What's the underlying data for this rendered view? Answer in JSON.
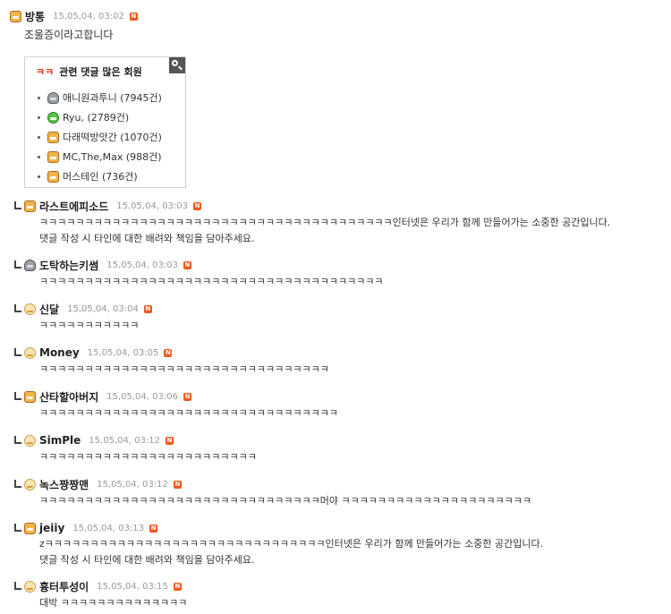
{
  "comments": [
    {
      "nick": "방통",
      "date": "15,05,04, 03:02",
      "lines": [
        "조울증이라고합니다"
      ]
    },
    {
      "nick": "라스트에피소드",
      "date": "15,05,04, 03:03",
      "lines": [
        "ㅋㅋㅋㅋㅋㅋㅋㅋㅋㅋㅋㅋㅋㅋㅋㅋㅋㅋㅋㅋㅋㅋㅋㅋㅋㅋㅋㅋㅋㅋㅋㅋㅋㅋㅋㅋㅋㅋㅋ인터넷은 우리가 함께 만들어가는 소중한 공간입니다.",
        "댓글 작성 시 타인에 대한 배려와 책임을 담아주세요."
      ]
    },
    {
      "nick": "도탁하는키썸",
      "date": "15,05,04, 03:03",
      "lines": [
        "ㅋㅋㅋㅋㅋㅋㅋㅋㅋㅋㅋㅋㅋㅋㅋㅋㅋㅋㅋㅋㅋㅋㅋㅋㅋㅋㅋㅋㅋㅋㅋㅋㅋㅋㅋㅋㅋㅋ"
      ]
    },
    {
      "nick": "신달",
      "date": "15,05,04, 03:04",
      "lines": [
        "ㅋㅋㅋㅋㅋㅋㅋㅋㅋㅋㅋ"
      ]
    },
    {
      "nick": "Money",
      "date": "15,05,04, 03:05",
      "lines": [
        "ㅋㅋㅋㅋㅋㅋㅋㅋㅋㅋㅋㅋㅋㅋㅋㅋㅋㅋㅋㅋㅋㅋㅋㅋㅋㅋㅋㅋㅋㅋㅋㅋ"
      ]
    },
    {
      "nick": "산타할아버지",
      "date": "15,05,04, 03:06",
      "lines": [
        "ㅋㅋㅋㅋㅋㅋㅋㅋㅋㅋㅋㅋㅋㅋㅋㅋㅋㅋㅋㅋㅋㅋㅋㅋㅋㅋㅋㅋㅋㅋㅋㅋㅋ"
      ]
    },
    {
      "nick": "SimPle",
      "date": "15,05,04, 03:12",
      "lines": [
        "ㅋㅋㅋㅋㅋㅋㅋㅋㅋㅋㅋㅋㅋㅋㅋㅋㅋㅋㅋㅋㅋㅋㅋㅋ"
      ]
    },
    {
      "nick": "녹스짱짱맨",
      "date": "15,05,04, 03:12",
      "lines": [
        "ㅋㅋㅋㅋㅋㅋㅋㅋㅋㅋㅋㅋㅋㅋㅋㅋㅋㅋㅋㅋㅋㅋㅋㅋㅋㅋㅋㅋㅋㅋㅋ머야 ㅋㅋㅋㅋㅋㅋㅋㅋㅋㅋㅋㅋㅋㅋㅋㅋㅋㅋㅋㅋㅋ"
      ]
    },
    {
      "nick": "jeiiy",
      "date": "15,05,04, 03:13",
      "lines": [
        "zㅋㅋㅋㅋㅋㅋㅋㅋㅋㅋㅋㅋㅋㅋㅋㅋㅋㅋㅋㅋㅋㅋㅋㅋㅋㅋㅋㅋㅋㅋㅋ인터넷은 우리가 함께 만들어가는 소중한 공간입니다.",
        "댓글 작성 시 타인에 대한 배려와 책임을 담아주세요."
      ]
    },
    {
      "nick": "흉터투성이",
      "date": "15,05,04, 03:15",
      "lines": [
        "대박 ㅋㅋㅋㅋㅋㅋㅋㅋㅋㅋㅋㅋㅋㅋ"
      ]
    }
  ],
  "new_badge": "N",
  "popup": {
    "kk": "ㅋㅋ",
    "title": "관련 댓글 많은 회원",
    "members": [
      {
        "name": "애니원과투니 (7945건)",
        "icon": "mouse"
      },
      {
        "name": "Ryu, (2789건)",
        "icon": "frog"
      },
      {
        "name": "다래떡방앗간 (1070건)",
        "icon": "tiger"
      },
      {
        "name": "MC,The,Max (988건)",
        "icon": "tiger"
      },
      {
        "name": "머스테인 (736건)",
        "icon": "tiger"
      }
    ]
  }
}
